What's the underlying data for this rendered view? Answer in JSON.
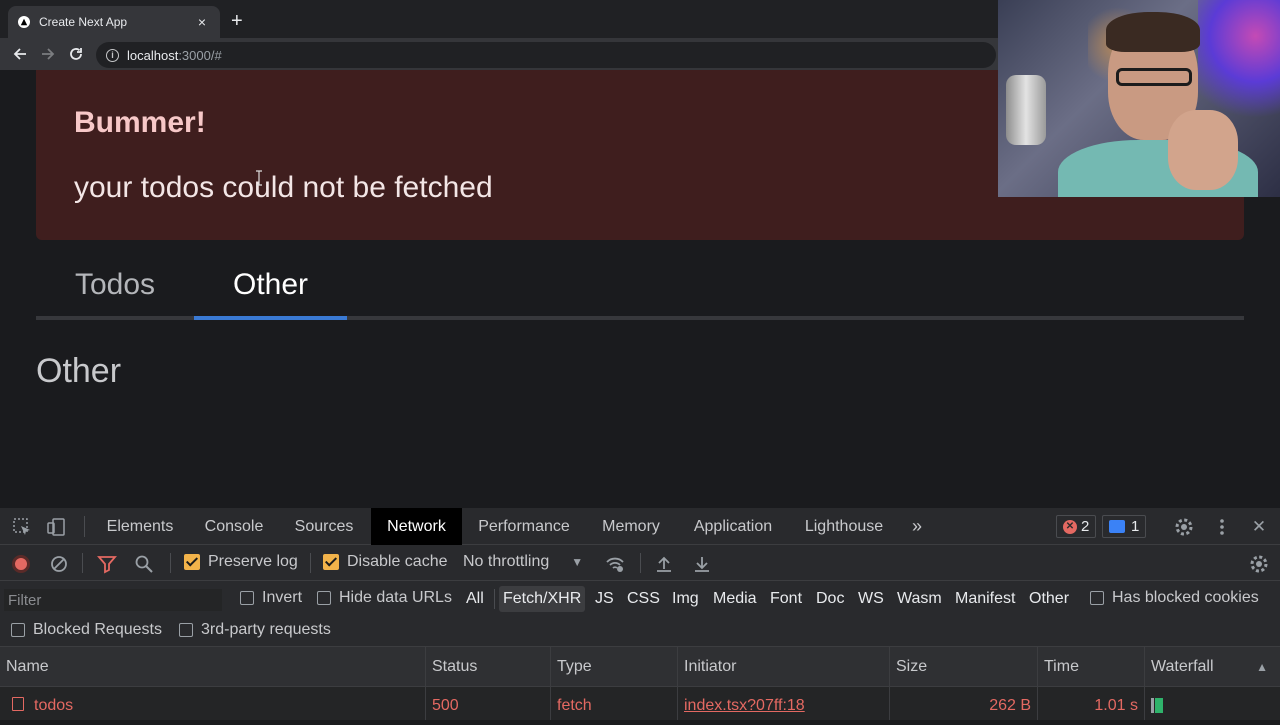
{
  "browser": {
    "tab_title": "Create Next App",
    "tab_close": "×",
    "new_tab": "+",
    "url_host": "localhost",
    "url_rest": ":3000/#"
  },
  "page": {
    "alert_title": "Bummer!",
    "alert_description": "your todos could not be fetched",
    "tabs": [
      {
        "label": "Todos",
        "active": false
      },
      {
        "label": "Other",
        "active": true
      }
    ],
    "panel_heading": "Other"
  },
  "devtools": {
    "tabs": [
      "Elements",
      "Console",
      "Sources",
      "Network",
      "Performance",
      "Memory",
      "Application",
      "Lighthouse"
    ],
    "active_tab": "Network",
    "more_tabs": "»",
    "error_count": "2",
    "message_count": "1",
    "close": "✕",
    "toolbar": {
      "preserve_log": "Preserve log",
      "disable_cache": "Disable cache",
      "throttling": "No throttling"
    },
    "filter": {
      "placeholder": "Filter",
      "invert": "Invert",
      "hide_data_urls": "Hide data URLs",
      "types": [
        "All",
        "Fetch/XHR",
        "JS",
        "CSS",
        "Img",
        "Media",
        "Font",
        "Doc",
        "WS",
        "Wasm",
        "Manifest",
        "Other"
      ],
      "active_type": "Fetch/XHR",
      "has_blocked_cookies": "Has blocked cookies",
      "blocked_requests": "Blocked Requests",
      "third_party": "3rd-party requests"
    },
    "columns": [
      "Name",
      "Status",
      "Type",
      "Initiator",
      "Size",
      "Time",
      "Waterfall"
    ],
    "sort_indicator": "▲",
    "rows": [
      {
        "name": "todos",
        "status": "500",
        "type": "fetch",
        "initiator": "index.tsx?07ff:18",
        "size": "262 B",
        "time": "1.01 s"
      }
    ],
    "colors": {
      "error": "#e46962",
      "accent": "#3a7ad4",
      "checkbox": "#f2b34a"
    }
  }
}
